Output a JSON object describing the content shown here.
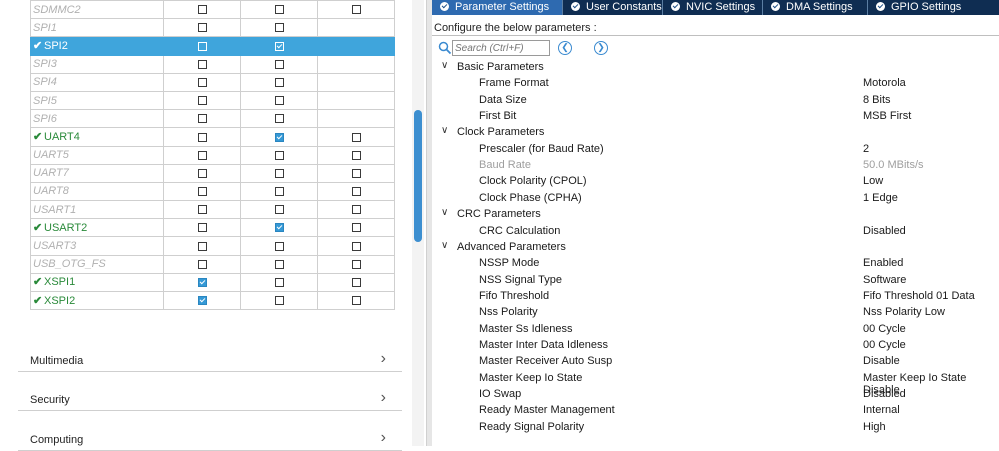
{
  "peripherals": [
    {
      "name": "SDMMC2",
      "state": "disabled",
      "c1": false,
      "c2": false,
      "c3": false,
      "has_c3": true
    },
    {
      "name": "SPI1",
      "state": "disabled",
      "c1": false,
      "c2": false,
      "c3": false,
      "has_c3": false
    },
    {
      "name": "SPI2",
      "state": "selected",
      "c1": false,
      "c2": true,
      "c3": false,
      "has_c3": false
    },
    {
      "name": "SPI3",
      "state": "disabled",
      "c1": false,
      "c2": false,
      "c3": false,
      "has_c3": false
    },
    {
      "name": "SPI4",
      "state": "disabled",
      "c1": false,
      "c2": false,
      "c3": false,
      "has_c3": false
    },
    {
      "name": "SPI5",
      "state": "disabled",
      "c1": false,
      "c2": false,
      "c3": false,
      "has_c3": false
    },
    {
      "name": "SPI6",
      "state": "disabled",
      "c1": false,
      "c2": false,
      "c3": false,
      "has_c3": false
    },
    {
      "name": "UART4",
      "state": "enabled",
      "c1": false,
      "c2": true,
      "c3": false,
      "has_c3": true
    },
    {
      "name": "UART5",
      "state": "disabled",
      "c1": false,
      "c2": false,
      "c3": false,
      "has_c3": true
    },
    {
      "name": "UART7",
      "state": "disabled",
      "c1": false,
      "c2": false,
      "c3": false,
      "has_c3": true
    },
    {
      "name": "UART8",
      "state": "disabled",
      "c1": false,
      "c2": false,
      "c3": false,
      "has_c3": true
    },
    {
      "name": "USART1",
      "state": "disabled",
      "c1": false,
      "c2": false,
      "c3": false,
      "has_c3": true
    },
    {
      "name": "USART2",
      "state": "enabled",
      "c1": false,
      "c2": true,
      "c3": false,
      "has_c3": true
    },
    {
      "name": "USART3",
      "state": "disabled",
      "c1": false,
      "c2": false,
      "c3": false,
      "has_c3": true
    },
    {
      "name": "USB_OTG_FS",
      "state": "disabled",
      "c1": false,
      "c2": false,
      "c3": false,
      "has_c3": true
    },
    {
      "name": "XSPI1",
      "state": "enabled",
      "c1": true,
      "c2": false,
      "c3": false,
      "has_c3": true
    },
    {
      "name": "XSPI2",
      "state": "enabled",
      "c1": true,
      "c2": false,
      "c3": false,
      "has_c3": true
    }
  ],
  "categories": {
    "multimedia": "Multimedia",
    "security": "Security",
    "computing": "Computing"
  },
  "tabs": [
    {
      "label": "Parameter Settings",
      "active": true
    },
    {
      "label": "User Constants",
      "active": false
    },
    {
      "label": "NVIC Settings",
      "active": false
    },
    {
      "label": "DMA Settings",
      "active": false
    },
    {
      "label": "GPIO Settings",
      "active": false
    }
  ],
  "config": {
    "heading": "Configure the below parameters :",
    "search_placeholder": "Search (Ctrl+F)"
  },
  "parameters": [
    {
      "type": "group",
      "name": "Basic Parameters"
    },
    {
      "type": "param",
      "name": "Frame Format",
      "value": "Motorola"
    },
    {
      "type": "param",
      "name": "Data Size",
      "value": "8 Bits"
    },
    {
      "type": "param",
      "name": "First Bit",
      "value": "MSB First"
    },
    {
      "type": "group",
      "name": "Clock Parameters"
    },
    {
      "type": "param",
      "name": "Prescaler (for Baud Rate)",
      "value": "2"
    },
    {
      "type": "param",
      "name": "Baud Rate",
      "value": "50.0 MBits/s",
      "dim": true
    },
    {
      "type": "param",
      "name": "Clock Polarity (CPOL)",
      "value": "Low"
    },
    {
      "type": "param",
      "name": "Clock Phase (CPHA)",
      "value": "1 Edge"
    },
    {
      "type": "group",
      "name": "CRC Parameters"
    },
    {
      "type": "param",
      "name": "CRC Calculation",
      "value": "Disabled"
    },
    {
      "type": "group",
      "name": "Advanced Parameters"
    },
    {
      "type": "param",
      "name": "NSSP Mode",
      "value": "Enabled"
    },
    {
      "type": "param",
      "name": "NSS Signal Type",
      "value": "Software"
    },
    {
      "type": "param",
      "name": "Fifo Threshold",
      "value": "Fifo Threshold 01 Data"
    },
    {
      "type": "param",
      "name": "Nss Polarity",
      "value": "Nss Polarity Low"
    },
    {
      "type": "param",
      "name": "Master Ss Idleness",
      "value": "00 Cycle"
    },
    {
      "type": "param",
      "name": "Master Inter Data Idleness",
      "value": "00 Cycle"
    },
    {
      "type": "param",
      "name": "Master Receiver Auto Susp",
      "value": "Disable"
    },
    {
      "type": "param",
      "name": "Master Keep Io State",
      "value": "Master Keep Io State Disable"
    },
    {
      "type": "param",
      "name": "IO Swap",
      "value": "Disabled"
    },
    {
      "type": "param",
      "name": "Ready Master Management",
      "value": "Internal"
    },
    {
      "type": "param",
      "name": "Ready Signal Polarity",
      "value": "High"
    }
  ]
}
